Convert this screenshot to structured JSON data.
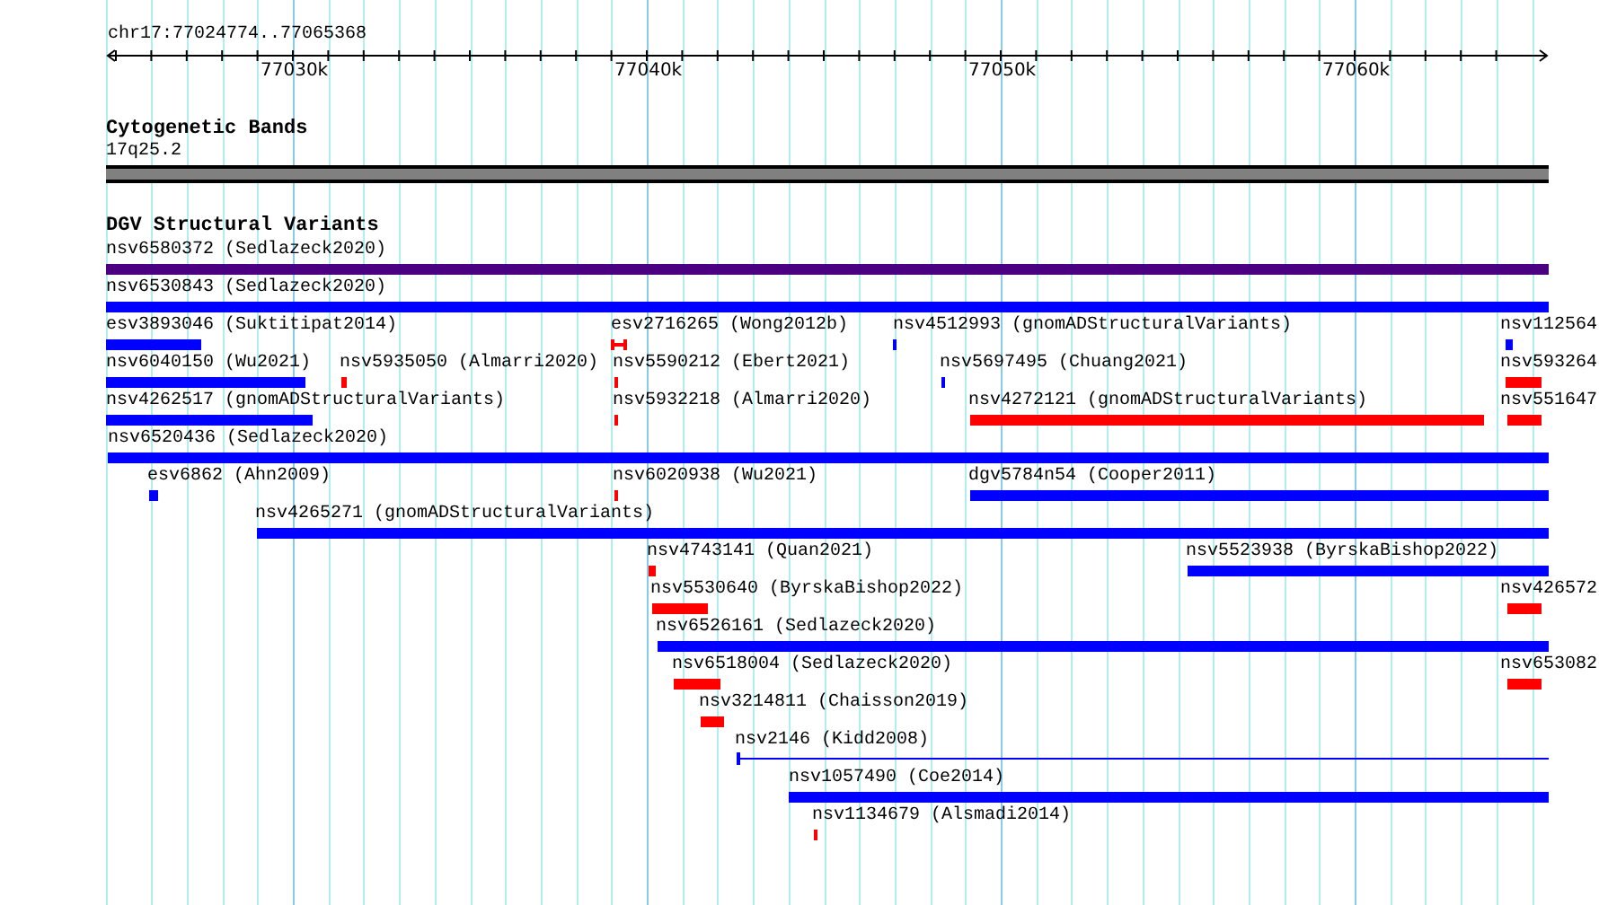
{
  "ruler": {
    "location": "chr17:77024774..77065368",
    "ticks": [
      "77030k",
      "77040k",
      "77050k",
      "77060k"
    ]
  },
  "tracks": [
    {
      "title": "Cytogenetic Bands",
      "features": [
        {
          "label": "17q25.2",
          "kind": "band",
          "color": "#808080"
        }
      ]
    },
    {
      "title": "DGV Structural Variants",
      "features": [
        {
          "label": "nsv6580372 (Sedlazeck2020)",
          "kind": "bar",
          "color": "#4b0082"
        },
        {
          "label": "nsv6530843 (Sedlazeck2020)",
          "kind": "bar",
          "color": "#0000ff"
        },
        {
          "label": "esv3893046 (Suktitipat2014)",
          "kind": "bar",
          "color": "#0000ff"
        },
        {
          "label": "esv2716265 (Wong2012b)",
          "kind": "span",
          "color": "#ff0000"
        },
        {
          "label": "nsv4512993 (gnomADStructuralVariants)",
          "kind": "bar",
          "color": "#0000ff"
        },
        {
          "label": "nsv112564",
          "kind": "bar",
          "color": "#0000ff"
        },
        {
          "label": "nsv6040150 (Wu2021)",
          "kind": "bar",
          "color": "#0000ff"
        },
        {
          "label": "nsv5935050 (Almarri2020)",
          "kind": "bar",
          "color": "#ff0000"
        },
        {
          "label": "nsv5590212 (Ebert2021)",
          "kind": "bar",
          "color": "#ff0000"
        },
        {
          "label": "nsv5697495 (Chuang2021)",
          "kind": "bar",
          "color": "#0000ff"
        },
        {
          "label": "nsv593264",
          "kind": "bar",
          "color": "#ff0000"
        },
        {
          "label": "nsv4262517 (gnomADStructuralVariants)",
          "kind": "bar",
          "color": "#0000ff"
        },
        {
          "label": "nsv5932218 (Almarri2020)",
          "kind": "bar",
          "color": "#ff0000"
        },
        {
          "label": "nsv4272121 (gnomADStructuralVariants)",
          "kind": "bar",
          "color": "#ff0000"
        },
        {
          "label": "nsv551647",
          "kind": "bar",
          "color": "#ff0000"
        },
        {
          "label": "nsv6520436 (Sedlazeck2020)",
          "kind": "bar",
          "color": "#0000ff"
        },
        {
          "label": "esv6862 (Ahn2009)",
          "kind": "bar",
          "color": "#0000ff"
        },
        {
          "label": "nsv6020938 (Wu2021)",
          "kind": "bar",
          "color": "#ff0000"
        },
        {
          "label": "dgv5784n54 (Cooper2011)",
          "kind": "bar",
          "color": "#0000ff"
        },
        {
          "label": "nsv4265271 (gnomADStructuralVariants)",
          "kind": "bar",
          "color": "#0000ff"
        },
        {
          "label": "nsv4743141 (Quan2021)",
          "kind": "bar",
          "color": "#ff0000"
        },
        {
          "label": "nsv5523938 (ByrskaBishop2022)",
          "kind": "bar",
          "color": "#0000ff"
        },
        {
          "label": "nsv5530640 (ByrskaBishop2022)",
          "kind": "bar",
          "color": "#ff0000"
        },
        {
          "label": "nsv426572",
          "kind": "bar",
          "color": "#ff0000"
        },
        {
          "label": "nsv6526161 (Sedlazeck2020)",
          "kind": "bar",
          "color": "#0000ff"
        },
        {
          "label": "nsv6518004 (Sedlazeck2020)",
          "kind": "bar",
          "color": "#ff0000"
        },
        {
          "label": "nsv653082",
          "kind": "bar",
          "color": "#ff0000"
        },
        {
          "label": "nsv3214811 (Chaisson2019)",
          "kind": "bar",
          "color": "#ff0000"
        },
        {
          "label": "nsv2146 (Kidd2008)",
          "kind": "line",
          "color": "#0000ff"
        },
        {
          "label": "nsv1057490 (Coe2014)",
          "kind": "bar",
          "color": "#0000ff"
        },
        {
          "label": "nsv1134679 (Alsmadi2014)",
          "kind": "bar",
          "color": "#ff0000"
        }
      ]
    }
  ]
}
